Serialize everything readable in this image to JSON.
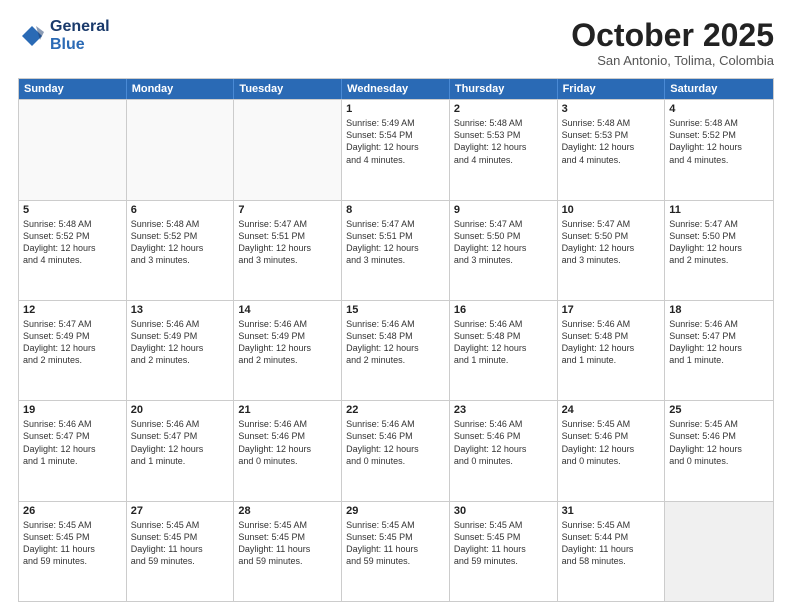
{
  "logo": {
    "line1": "General",
    "line2": "Blue"
  },
  "title": "October 2025",
  "subtitle": "San Antonio, Tolima, Colombia",
  "days": [
    "Sunday",
    "Monday",
    "Tuesday",
    "Wednesday",
    "Thursday",
    "Friday",
    "Saturday"
  ],
  "rows": [
    [
      {
        "day": "",
        "text": "",
        "empty": true
      },
      {
        "day": "",
        "text": "",
        "empty": true
      },
      {
        "day": "",
        "text": "",
        "empty": true
      },
      {
        "day": "1",
        "text": "Sunrise: 5:49 AM\nSunset: 5:54 PM\nDaylight: 12 hours\nand 4 minutes.",
        "empty": false
      },
      {
        "day": "2",
        "text": "Sunrise: 5:48 AM\nSunset: 5:53 PM\nDaylight: 12 hours\nand 4 minutes.",
        "empty": false
      },
      {
        "day": "3",
        "text": "Sunrise: 5:48 AM\nSunset: 5:53 PM\nDaylight: 12 hours\nand 4 minutes.",
        "empty": false
      },
      {
        "day": "4",
        "text": "Sunrise: 5:48 AM\nSunset: 5:52 PM\nDaylight: 12 hours\nand 4 minutes.",
        "empty": false
      }
    ],
    [
      {
        "day": "5",
        "text": "Sunrise: 5:48 AM\nSunset: 5:52 PM\nDaylight: 12 hours\nand 4 minutes.",
        "empty": false
      },
      {
        "day": "6",
        "text": "Sunrise: 5:48 AM\nSunset: 5:52 PM\nDaylight: 12 hours\nand 3 minutes.",
        "empty": false
      },
      {
        "day": "7",
        "text": "Sunrise: 5:47 AM\nSunset: 5:51 PM\nDaylight: 12 hours\nand 3 minutes.",
        "empty": false
      },
      {
        "day": "8",
        "text": "Sunrise: 5:47 AM\nSunset: 5:51 PM\nDaylight: 12 hours\nand 3 minutes.",
        "empty": false
      },
      {
        "day": "9",
        "text": "Sunrise: 5:47 AM\nSunset: 5:50 PM\nDaylight: 12 hours\nand 3 minutes.",
        "empty": false
      },
      {
        "day": "10",
        "text": "Sunrise: 5:47 AM\nSunset: 5:50 PM\nDaylight: 12 hours\nand 3 minutes.",
        "empty": false
      },
      {
        "day": "11",
        "text": "Sunrise: 5:47 AM\nSunset: 5:50 PM\nDaylight: 12 hours\nand 2 minutes.",
        "empty": false
      }
    ],
    [
      {
        "day": "12",
        "text": "Sunrise: 5:47 AM\nSunset: 5:49 PM\nDaylight: 12 hours\nand 2 minutes.",
        "empty": false
      },
      {
        "day": "13",
        "text": "Sunrise: 5:46 AM\nSunset: 5:49 PM\nDaylight: 12 hours\nand 2 minutes.",
        "empty": false
      },
      {
        "day": "14",
        "text": "Sunrise: 5:46 AM\nSunset: 5:49 PM\nDaylight: 12 hours\nand 2 minutes.",
        "empty": false
      },
      {
        "day": "15",
        "text": "Sunrise: 5:46 AM\nSunset: 5:48 PM\nDaylight: 12 hours\nand 2 minutes.",
        "empty": false
      },
      {
        "day": "16",
        "text": "Sunrise: 5:46 AM\nSunset: 5:48 PM\nDaylight: 12 hours\nand 1 minute.",
        "empty": false
      },
      {
        "day": "17",
        "text": "Sunrise: 5:46 AM\nSunset: 5:48 PM\nDaylight: 12 hours\nand 1 minute.",
        "empty": false
      },
      {
        "day": "18",
        "text": "Sunrise: 5:46 AM\nSunset: 5:47 PM\nDaylight: 12 hours\nand 1 minute.",
        "empty": false
      }
    ],
    [
      {
        "day": "19",
        "text": "Sunrise: 5:46 AM\nSunset: 5:47 PM\nDaylight: 12 hours\nand 1 minute.",
        "empty": false
      },
      {
        "day": "20",
        "text": "Sunrise: 5:46 AM\nSunset: 5:47 PM\nDaylight: 12 hours\nand 1 minute.",
        "empty": false
      },
      {
        "day": "21",
        "text": "Sunrise: 5:46 AM\nSunset: 5:46 PM\nDaylight: 12 hours\nand 0 minutes.",
        "empty": false
      },
      {
        "day": "22",
        "text": "Sunrise: 5:46 AM\nSunset: 5:46 PM\nDaylight: 12 hours\nand 0 minutes.",
        "empty": false
      },
      {
        "day": "23",
        "text": "Sunrise: 5:46 AM\nSunset: 5:46 PM\nDaylight: 12 hours\nand 0 minutes.",
        "empty": false
      },
      {
        "day": "24",
        "text": "Sunrise: 5:45 AM\nSunset: 5:46 PM\nDaylight: 12 hours\nand 0 minutes.",
        "empty": false
      },
      {
        "day": "25",
        "text": "Sunrise: 5:45 AM\nSunset: 5:46 PM\nDaylight: 12 hours\nand 0 minutes.",
        "empty": false
      }
    ],
    [
      {
        "day": "26",
        "text": "Sunrise: 5:45 AM\nSunset: 5:45 PM\nDaylight: 11 hours\nand 59 minutes.",
        "empty": false
      },
      {
        "day": "27",
        "text": "Sunrise: 5:45 AM\nSunset: 5:45 PM\nDaylight: 11 hours\nand 59 minutes.",
        "empty": false
      },
      {
        "day": "28",
        "text": "Sunrise: 5:45 AM\nSunset: 5:45 PM\nDaylight: 11 hours\nand 59 minutes.",
        "empty": false
      },
      {
        "day": "29",
        "text": "Sunrise: 5:45 AM\nSunset: 5:45 PM\nDaylight: 11 hours\nand 59 minutes.",
        "empty": false
      },
      {
        "day": "30",
        "text": "Sunrise: 5:45 AM\nSunset: 5:45 PM\nDaylight: 11 hours\nand 59 minutes.",
        "empty": false
      },
      {
        "day": "31",
        "text": "Sunrise: 5:45 AM\nSunset: 5:44 PM\nDaylight: 11 hours\nand 58 minutes.",
        "empty": false
      },
      {
        "day": "",
        "text": "",
        "empty": true,
        "shaded": true
      }
    ]
  ]
}
